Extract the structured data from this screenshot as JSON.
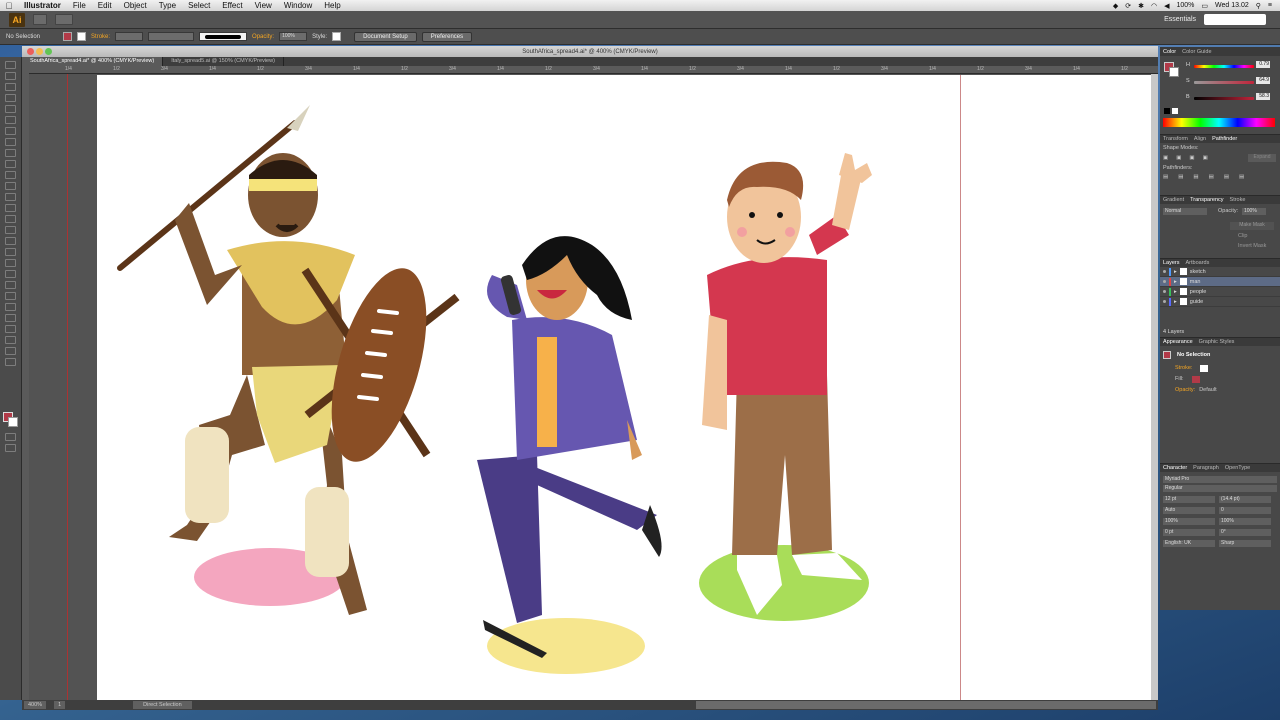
{
  "menubar": {
    "app_name": "Illustrator",
    "items": [
      "File",
      "Edit",
      "Object",
      "Type",
      "Select",
      "Effect",
      "View",
      "Window",
      "Help"
    ],
    "battery": "100%",
    "clock": "Wed 13.02"
  },
  "appbar": {
    "logo": "Ai",
    "workspace": "Essentials"
  },
  "control": {
    "selection_label": "No Selection",
    "stroke_label": "Stroke:",
    "opacity_label": "Opacity:",
    "opacity_value": "100%",
    "style_label": "Style:",
    "document_setup": "Document Setup",
    "preferences": "Preferences"
  },
  "document": {
    "window_title": "SouthAfrica_spread4.ai* @ 400% (CMYK/Preview)",
    "tabs": [
      {
        "label": "SouthAfrica_spread4.ai* @ 400% (CMYK/Preview)"
      },
      {
        "label": "Italy_spread5.ai @ 150% (CMYK/Preview)"
      }
    ],
    "ruler_labels": [
      "1/4",
      "1/2",
      "3/4",
      "1/4",
      "1/2",
      "3/4",
      "1/4",
      "1/2",
      "3/4",
      "1/4",
      "1/2",
      "3/4",
      "1/4",
      "1/2",
      "3/4",
      "1/4",
      "1/2",
      "3/4",
      "1/4",
      "1/2",
      "3/4",
      "1/4",
      "1/2"
    ]
  },
  "status": {
    "zoom": "400%",
    "page": "1",
    "tool": "Direct Selection"
  },
  "panels": {
    "color": {
      "tabs": [
        "Color",
        "Color Guide"
      ],
      "channels": [
        {
          "label": "H",
          "value": "0.79"
        },
        {
          "label": "S",
          "value": "64.9"
        },
        {
          "label": "B",
          "value": "58.3"
        }
      ]
    },
    "transform_tabs": [
      "Transform",
      "Align",
      "Pathfinder"
    ],
    "shape_modes": "Shape Modes:",
    "expand": "Expand",
    "pathfinders": "Pathfinders:",
    "transparency_tabs": [
      "Gradient",
      "Transparency",
      "Stroke"
    ],
    "blend_mode": "Normal",
    "opacity_label": "Opacity:",
    "opacity_value": "100%",
    "make_mask": "Make Mask",
    "clip": "Clip",
    "invert_mask": "Invert Mask",
    "layers_tabs": [
      "Layers",
      "Artboards"
    ],
    "layers": [
      {
        "name": "sketch",
        "color": "#4f9bff"
      },
      {
        "name": "man",
        "color": "#e04444"
      },
      {
        "name": "people",
        "color": "#38c05a"
      },
      {
        "name": "guide",
        "color": "#5a6bff"
      }
    ],
    "layers_count": "4 Layers",
    "appearance_tabs": [
      "Appearance",
      "Graphic Styles"
    ],
    "appearance_title": "No Selection",
    "stroke": "Stroke:",
    "fill": "Fill:",
    "opacity": "Opacity:",
    "opacity_default": "Default",
    "character_tabs": [
      "Character",
      "Paragraph",
      "OpenType"
    ],
    "font": "Myriad Pro",
    "style": "Regular",
    "size": "12 pt",
    "leading": "(14.4 pt)",
    "kerning": "Auto",
    "tracking": "0",
    "scale_v": "100%",
    "scale_h": "100%",
    "baseline": "0 pt",
    "rotation": "0°",
    "language": "English: UK",
    "aa": "Sharp"
  }
}
